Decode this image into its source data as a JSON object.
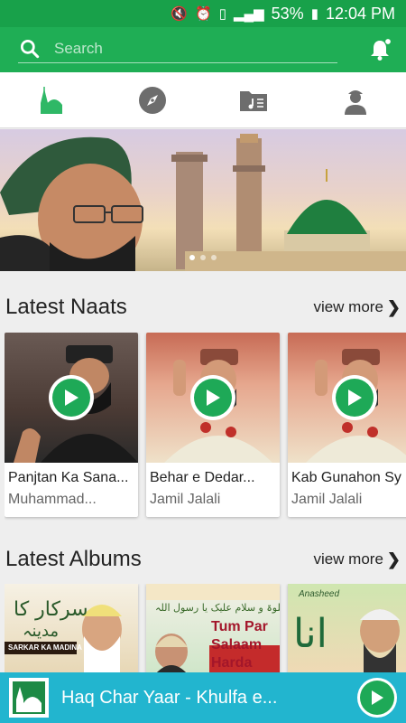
{
  "status_bar": {
    "battery": "53%",
    "time": "12:04 PM",
    "icons": [
      "mute-vibrate-icon",
      "alarm-icon",
      "sim-1-icon",
      "signal-icon",
      "battery-charging-icon"
    ]
  },
  "search": {
    "placeholder": "Search",
    "icon": "search-icon",
    "notification_icon": "bell-icon"
  },
  "tabs": [
    {
      "icon": "mosque-icon",
      "active": true
    },
    {
      "icon": "compass-icon",
      "active": false
    },
    {
      "icon": "music-folder-icon",
      "active": false
    },
    {
      "icon": "profile-icon",
      "active": false
    }
  ],
  "banner": {
    "slides": 3,
    "active_slide": 0
  },
  "latest_naats": {
    "title": "Latest Naats",
    "view_more": "view more",
    "items": [
      {
        "title": "Panjtan Ka Sana...",
        "artist": "Muhammad..."
      },
      {
        "title": "Behar e Dedar...",
        "artist": "Jamil Jalali"
      },
      {
        "title": "Kab Gunahon Sy",
        "artist": "Jamil Jalali"
      }
    ]
  },
  "latest_albums": {
    "title": "Latest Albums",
    "view_more": "view more",
    "items": [
      {
        "caption": "SARKAR KA MADINA"
      },
      {
        "caption": "Tum Par Salaam Harda"
      },
      {
        "caption": "Anasheed"
      }
    ]
  },
  "player": {
    "now_playing": "Haq Char Yaar - Khulfa e...",
    "accent": "#22b5cf"
  },
  "colors": {
    "primary": "#1fae55",
    "status": "#18a14a",
    "play": "#1ea957"
  }
}
